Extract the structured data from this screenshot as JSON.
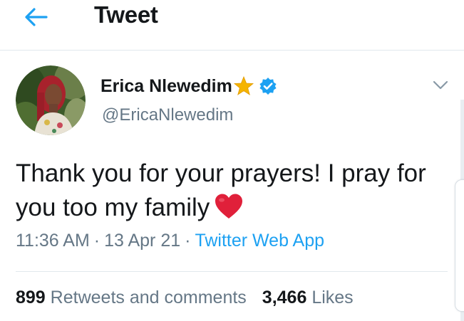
{
  "header": {
    "title": "Tweet"
  },
  "tweet": {
    "display_name": "Erica Nlewedim",
    "handle": "@EricaNlewedim",
    "text": "Thank you for your prayers! I pray for you too my family",
    "time": "11:36 AM",
    "date": "13 Apr 21",
    "separator": "·",
    "source": "Twitter Web App",
    "retweets_count": "899",
    "retweets_label": "Retweets and comments",
    "likes_count": "3,466",
    "likes_label": "Likes"
  },
  "icons": {
    "back": "arrow-left-icon",
    "star": "star-icon",
    "verified": "verified-badge-icon",
    "caret": "chevron-down-icon",
    "heart": "red-heart-emoji"
  },
  "colors": {
    "accent": "#1da1f2",
    "text_primary": "#14171a",
    "text_secondary": "#657786",
    "divider": "#e1e8ed",
    "heart": "#e0203a",
    "star": "#f5b400"
  }
}
